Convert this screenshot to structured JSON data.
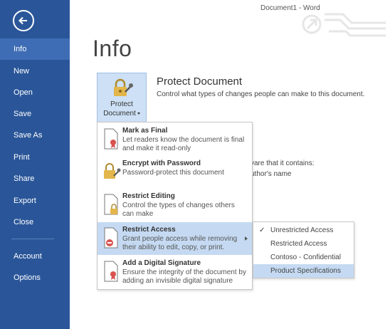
{
  "window": {
    "title": "Document1 - Word"
  },
  "sidebar": {
    "back_label": "Back",
    "items": [
      {
        "label": "Info"
      },
      {
        "label": "New"
      },
      {
        "label": "Open"
      },
      {
        "label": "Save"
      },
      {
        "label": "Save As"
      },
      {
        "label": "Print"
      },
      {
        "label": "Share"
      },
      {
        "label": "Export"
      },
      {
        "label": "Close"
      },
      {
        "label": "Account"
      },
      {
        "label": "Options"
      }
    ],
    "active": "Info"
  },
  "page": {
    "title": "Info"
  },
  "protect": {
    "button_line1": "Protect",
    "button_line2": "Document",
    "heading": "Protect Document",
    "description": "Control what types of changes people can make to this document."
  },
  "background_text": {
    "line1": "vare that it contains:",
    "line2": "uthor's name"
  },
  "menu": {
    "items": [
      {
        "title": "Mark as Final",
        "desc": "Let readers know the document is final and make it read-only"
      },
      {
        "title": "Encrypt with Password",
        "desc": "Password-protect this document"
      },
      {
        "title": "Restrict Editing",
        "desc": "Control the types of changes others can make"
      },
      {
        "title": "Restrict Access",
        "desc": "Grant people access while removing their ability to edit, copy, or print."
      },
      {
        "title": "Add a Digital Signature",
        "desc": "Ensure the integrity of the document by adding an invisible digital signature"
      }
    ]
  },
  "submenu": {
    "items": [
      {
        "label": "Unrestricted Access",
        "checked": true
      },
      {
        "label": "Restricted Access",
        "checked": false
      },
      {
        "label": "Contoso - Confidential",
        "checked": false
      },
      {
        "label": "Product Specifications",
        "checked": false
      }
    ],
    "check_glyph": "✓"
  },
  "colors": {
    "sidebar": "#2a5699",
    "sidebar_active": "#3e6db5",
    "highlight": "#c5daf2",
    "button_bg": "#cde0f5"
  }
}
